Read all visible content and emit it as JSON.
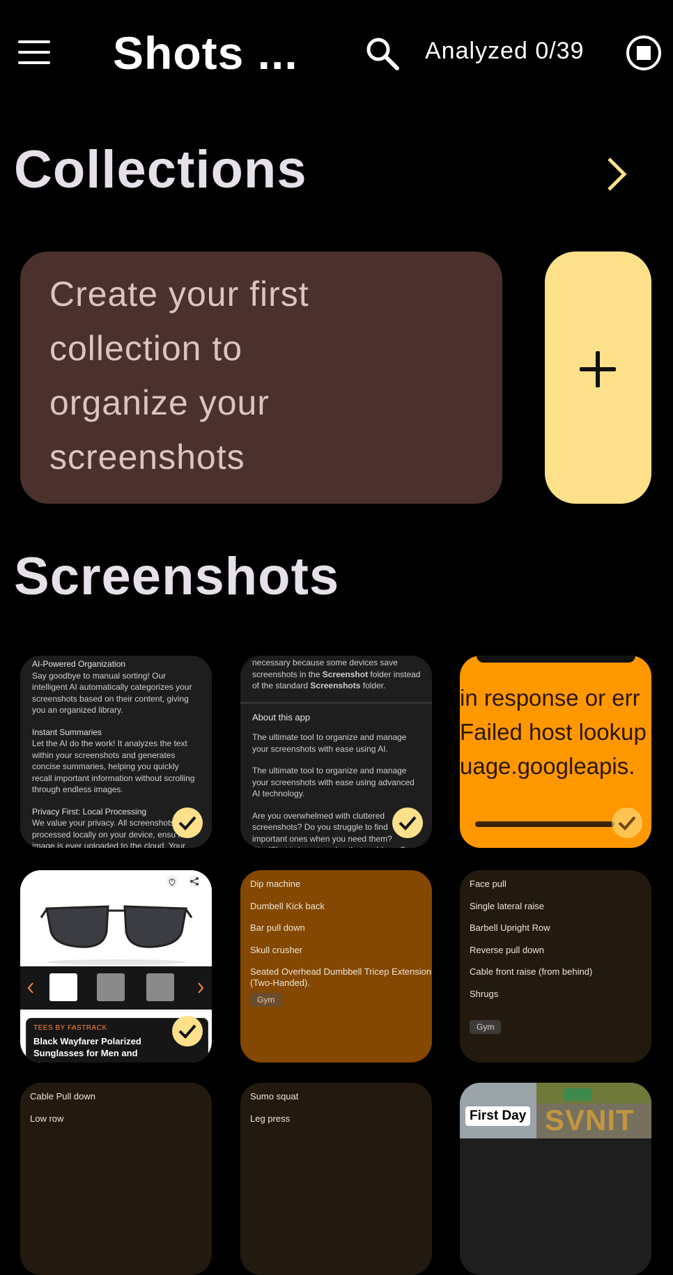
{
  "header": {
    "title": "Shots ...",
    "analyzed": "Analyzed 0/39"
  },
  "collections": {
    "title": "Collections",
    "empty_line1": "Create your first",
    "empty_line2": "collection to",
    "empty_line3": "organize your",
    "empty_line4": "screenshots",
    "add_label": "+"
  },
  "screenshots": {
    "title": "Screenshots",
    "tile1": {
      "l1": "AI-Powered Organization",
      "l2": "Say goodbye to manual sorting! Our intelligent AI automatically categorizes your screenshots based on their content, giving you an organized library.",
      "l3": "Instant Summaries",
      "l4": "Let the AI do the work! It analyzes the text within your screenshots and generates concise summaries, helping you quickly recall important information without scrolling through endless images.",
      "l5": "Privacy First: Local Processing",
      "l6": "We value your privacy. All screenshots processed locally on your device, ensu no image is ever uploaded to the cloud. Your"
    },
    "tile2": {
      "l0": "necessary because some devices save",
      "l1a": "screenshots in the ",
      "l1b": "Screenshot",
      "l1c": " folder instead of the standard ",
      "l1d": "Screenshots",
      "l1e": " folder.",
      "about": "About this app",
      "p1": "The ultimate tool to organize and manage your screenshots with ease using AI.",
      "p2": "The ultimate tool to organize and manage your screenshots with ease using advanced AI technology.",
      "p3": "Are you overwhelmed with cluttered screenshots? Do you struggle to find important ones when you need them? PixelShot is here to solve that problem. Our cutting-edge AI to automatically"
    },
    "tile3": {
      "line1": "in response or err",
      "line2": "Failed host lookup",
      "line3": "uage.googleapis."
    },
    "tile4": {
      "brand": "TEES BY FASTRACK",
      "name": "Black Wayfarer Polarized Sunglasses for Men and"
    },
    "tile5": {
      "items": [
        "Dip machine",
        "Dumbell Kick back",
        "Bar pull down",
        "Skull crusher",
        "Seated Overhead Dumbbell Tricep Extension (Two-Handed)."
      ],
      "tag": "Gym"
    },
    "tile6": {
      "items": [
        "Face pull",
        "Single lateral raise",
        "Barbell Upright Row",
        "Reverse pull down",
        "Cable front raise (from behind)",
        "Shrugs"
      ],
      "tag": "Gym"
    },
    "tile7": {
      "items": [
        "Cable Pull down",
        "Low row"
      ]
    },
    "tile8": {
      "items": [
        "Sumo squat",
        "Leg press"
      ]
    },
    "tile9": {
      "label": "First Day",
      "sign": "SVNIT"
    }
  },
  "colors": {
    "accent": "#fde08a",
    "collection_card": "#4a312b",
    "tile_brown": "#844802",
    "tile_orange": "#ff9800"
  }
}
